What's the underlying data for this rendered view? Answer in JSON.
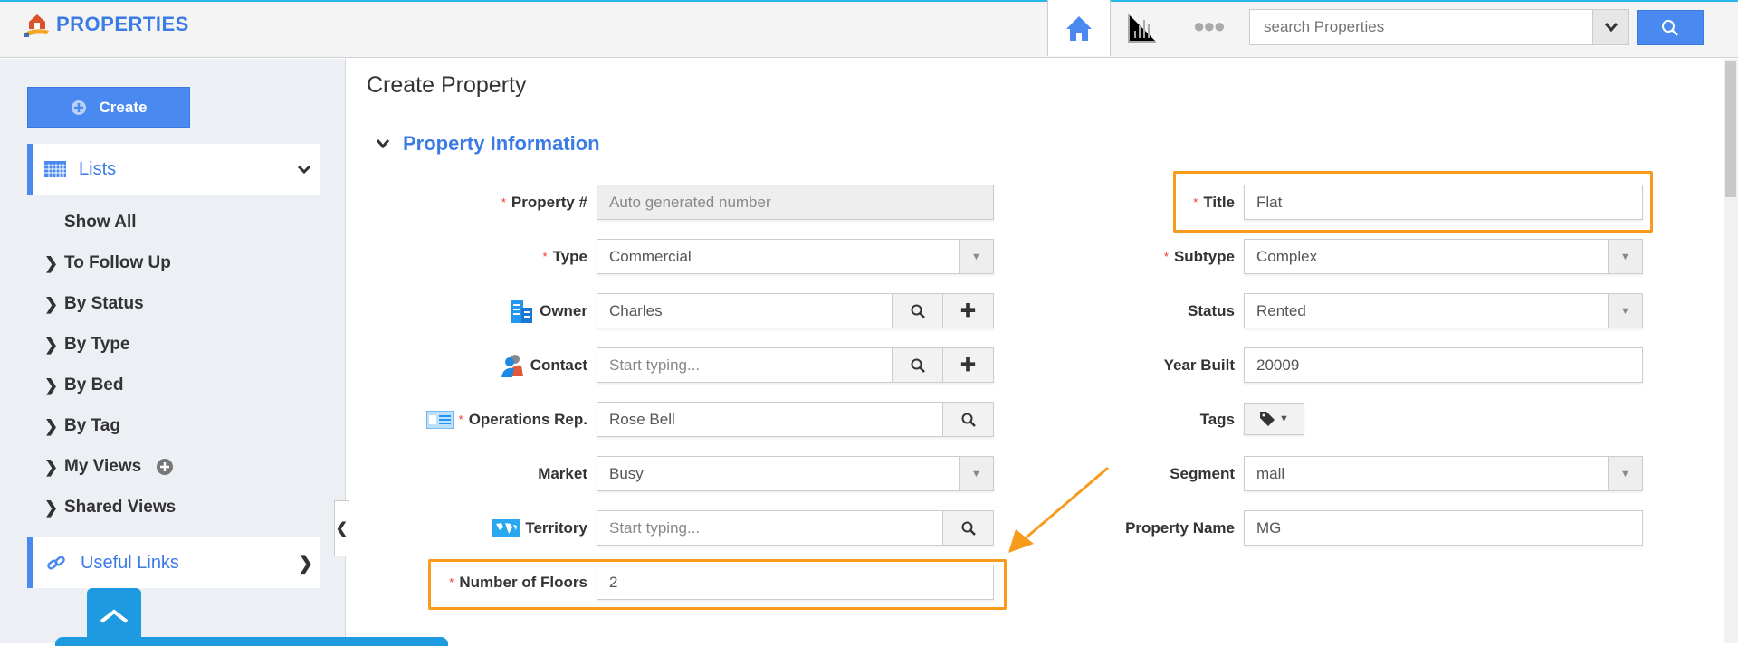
{
  "app": {
    "title": "PROPERTIES",
    "logo_icon": "house-hand-icon"
  },
  "header": {
    "nav": [
      {
        "icon": "home-icon",
        "active": true
      },
      {
        "icon": "bar-chart-icon"
      },
      {
        "icon": "more-dots-icon"
      }
    ],
    "search": {
      "placeholder": "search Properties",
      "button_icon": "search-icon"
    }
  },
  "sidebar": {
    "create_label": "Create",
    "lists": {
      "label": "Lists",
      "icon": "calendar-grid-icon"
    },
    "items": [
      {
        "label": "Show All"
      },
      {
        "label": "To Follow Up"
      },
      {
        "label": "By Status"
      },
      {
        "label": "By Type"
      },
      {
        "label": "By Bed"
      },
      {
        "label": "By Tag"
      },
      {
        "label": "My Views"
      },
      {
        "label": "Shared Views"
      }
    ],
    "useful_links": {
      "label": "Useful Links",
      "icon": "link-icon"
    }
  },
  "main": {
    "title": "Create Property",
    "section": "Property Information",
    "left": [
      {
        "label": "Property #",
        "required": true,
        "value": "Auto generated number",
        "readonly": true
      },
      {
        "label": "Type",
        "required": true,
        "value": "Commercial",
        "kind": "select"
      },
      {
        "label": "Owner",
        "value": "Charles",
        "icon": "building-icon",
        "kind": "lookup-add"
      },
      {
        "label": "Contact",
        "placeholder": "Start typing...",
        "icon": "contacts-icon",
        "kind": "lookup-add"
      },
      {
        "label": "Operations Rep.",
        "required": true,
        "value": "Rose Bell",
        "icon": "id-card-icon",
        "kind": "lookup"
      },
      {
        "label": "Market",
        "value": "Busy",
        "kind": "select"
      },
      {
        "label": "Territory",
        "placeholder": "Start typing...",
        "icon": "world-map-icon",
        "kind": "lookup"
      },
      {
        "label": "Number of Floors",
        "required": true,
        "value": "2",
        "highlighted": true
      }
    ],
    "right": [
      {
        "label": "Title",
        "required": true,
        "value": "Flat",
        "highlighted": true
      },
      {
        "label": "Subtype",
        "required": true,
        "value": "Complex",
        "kind": "select"
      },
      {
        "label": "Status",
        "value": "Rented",
        "kind": "select"
      },
      {
        "label": "Year Built",
        "value": "20009"
      },
      {
        "label": "Tags",
        "kind": "tag-button"
      },
      {
        "label": "Segment",
        "value": "mall",
        "kind": "select"
      },
      {
        "label": "Property Name",
        "value": "MG"
      }
    ]
  },
  "colors": {
    "accent": "#3b7be6",
    "highlight": "#f89a1c",
    "sidebar_bg": "#eceff4"
  }
}
